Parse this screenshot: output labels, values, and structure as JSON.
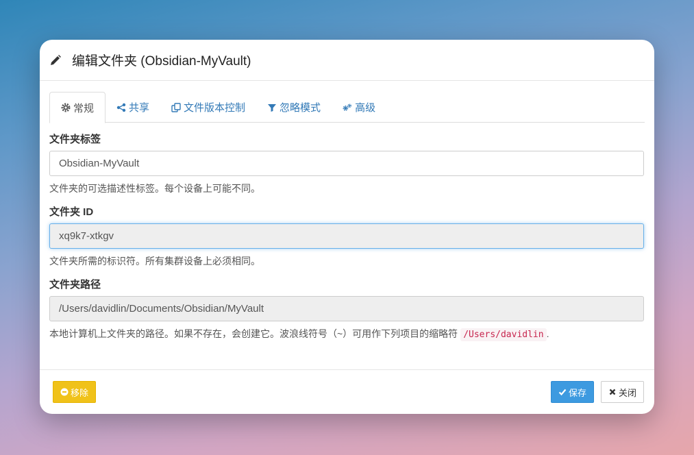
{
  "modal": {
    "title": "编辑文件夹 (Obsidian-MyVault)",
    "icons": {
      "title": "pencil-icon"
    }
  },
  "tabs": [
    {
      "label": "常规",
      "icon": "gear-icon",
      "active": true
    },
    {
      "label": "共享",
      "icon": "share-icon",
      "active": false
    },
    {
      "label": "文件版本控制",
      "icon": "copy-icon",
      "active": false
    },
    {
      "label": "忽略模式",
      "icon": "filter-icon",
      "active": false
    },
    {
      "label": "高级",
      "icon": "gears-icon",
      "active": false
    }
  ],
  "fields": {
    "label": {
      "title": "文件夹标签",
      "value": "Obsidian-MyVault",
      "help": "文件夹的可选描述性标签。每个设备上可能不同。"
    },
    "id": {
      "title": "文件夹 ID",
      "value": "xq9k7-xtkgv",
      "help": "文件夹所需的标识符。所有集群设备上必须相同。"
    },
    "path": {
      "title": "文件夹路径",
      "value": "/Users/davidlin/Documents/Obsidian/MyVault",
      "help": "本地计算机上文件夹的路径。如果不存在，会创建它。波浪线符号（~）可用作下列项目的缩略符",
      "help_code": "/Users/davidlin",
      "help_end": "."
    }
  },
  "footer": {
    "remove_label": "移除",
    "save_label": "保存",
    "close_label": "关闭"
  },
  "colors": {
    "link": "#337ab7",
    "remove": "#f0c21a",
    "save": "#3d9ae0",
    "code": "#c7254e"
  }
}
